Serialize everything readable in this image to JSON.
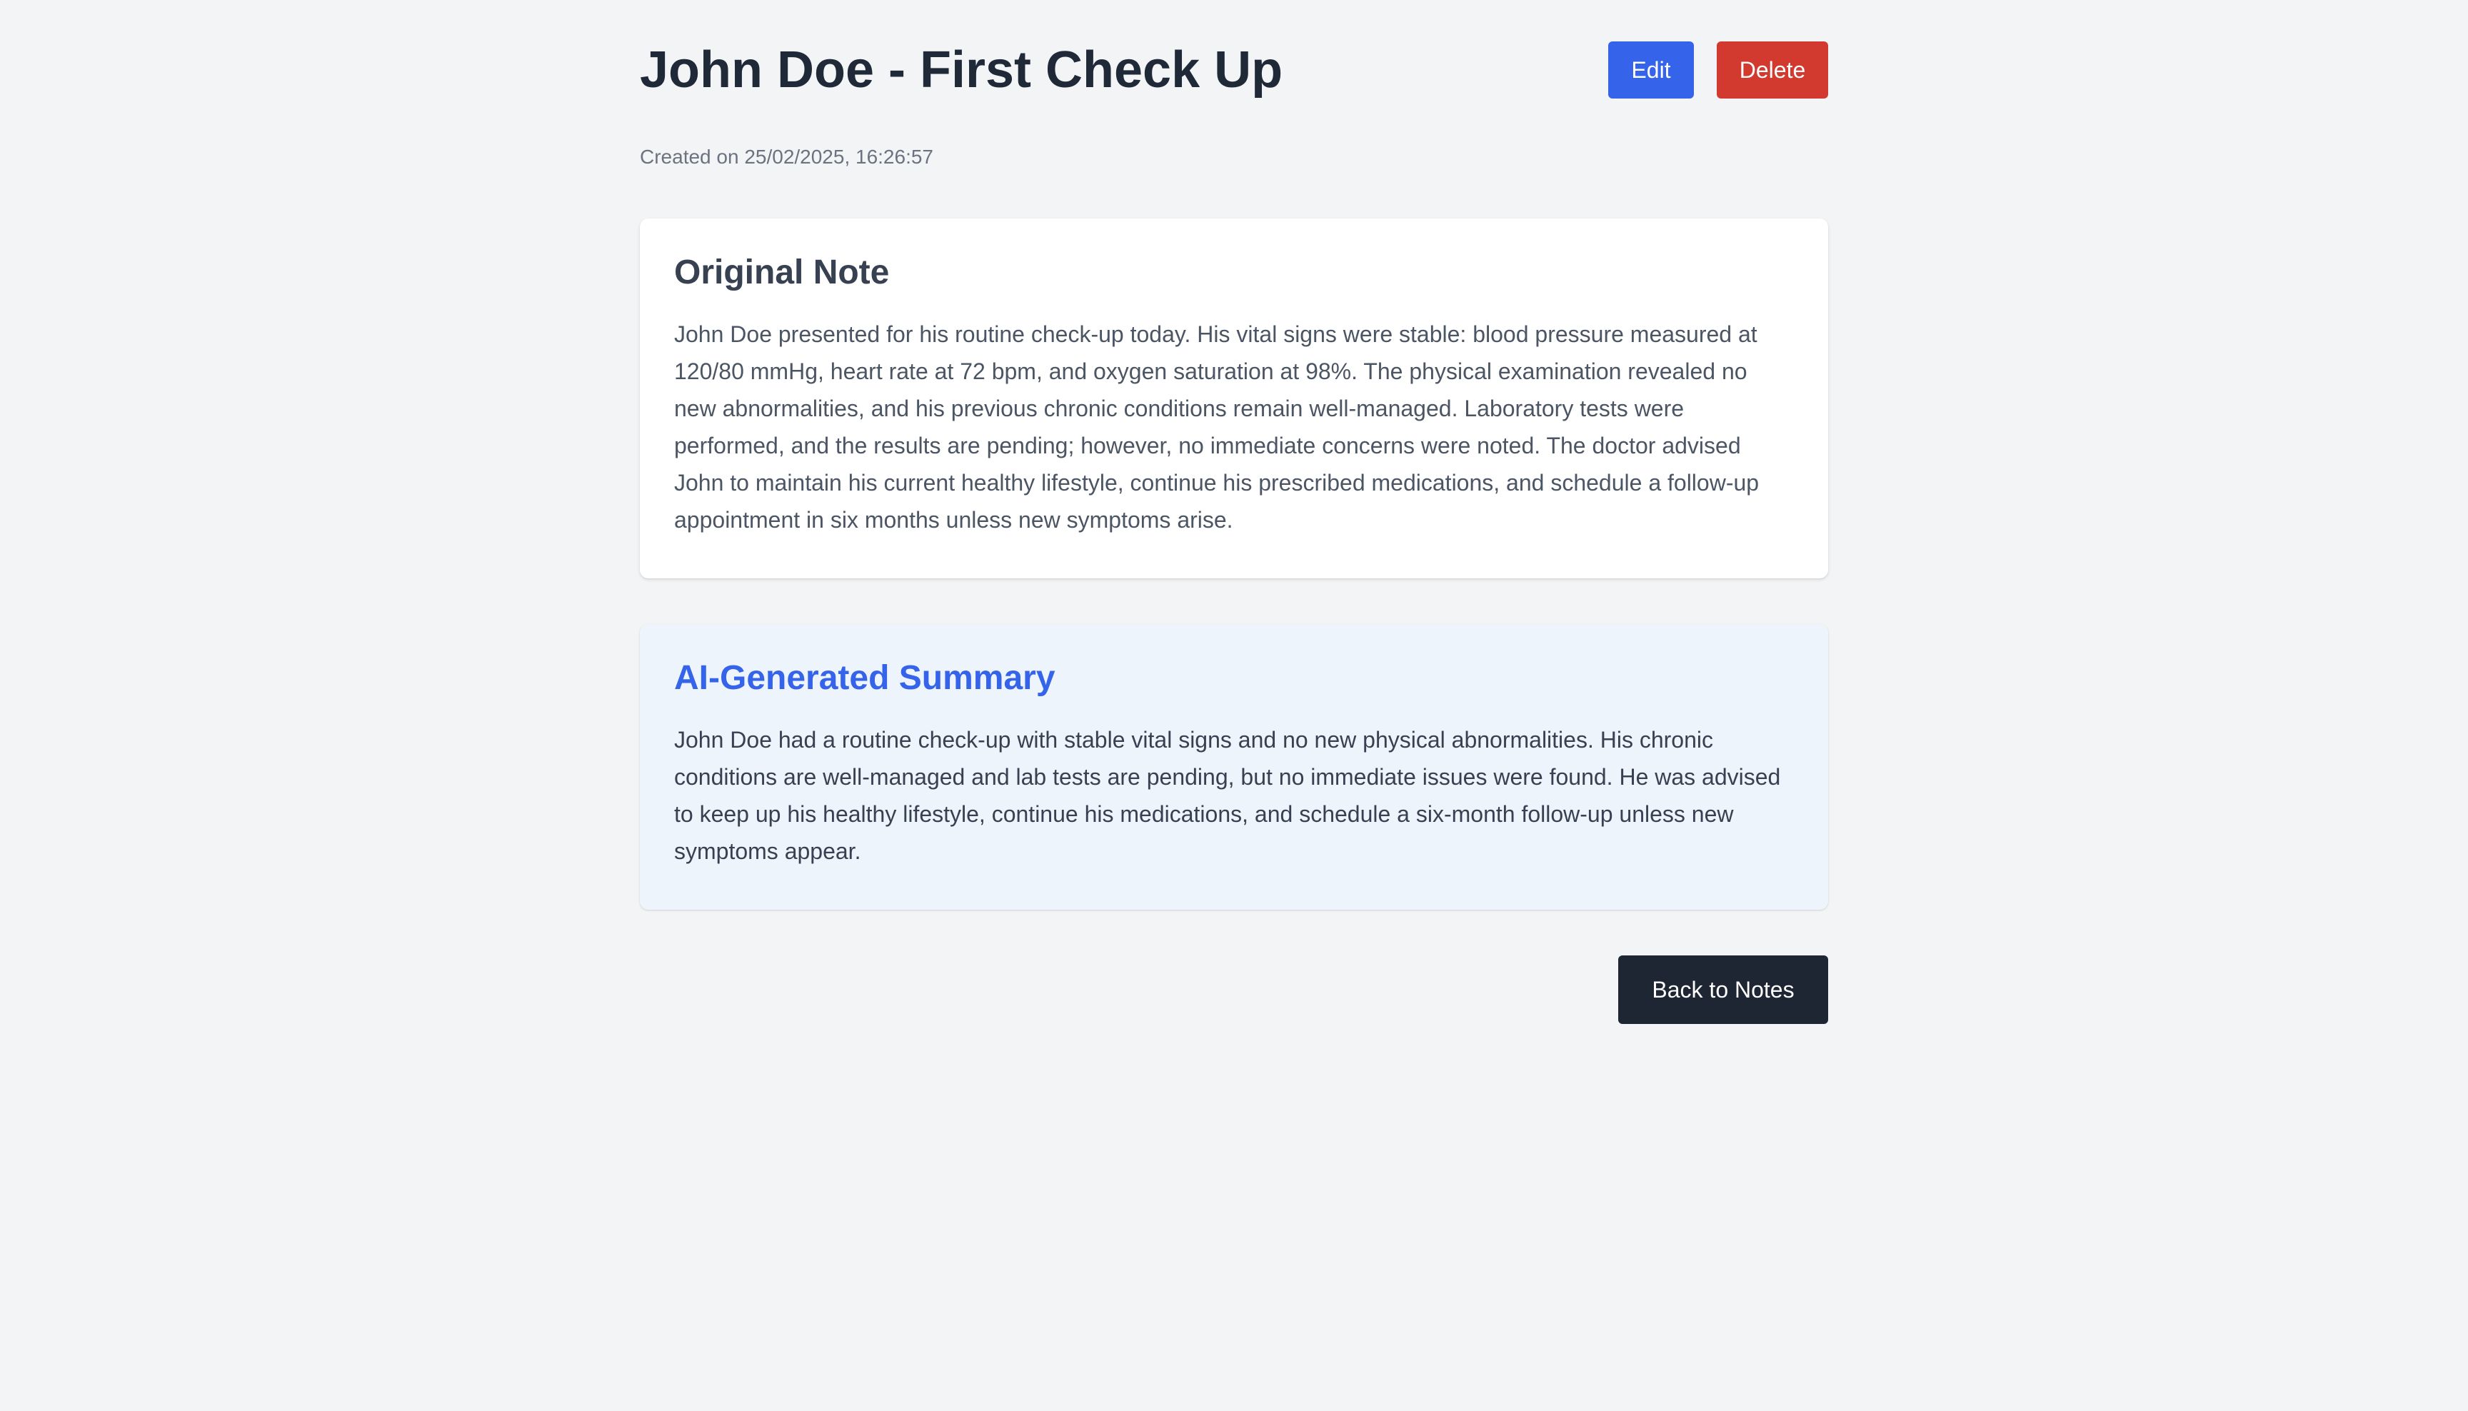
{
  "header": {
    "title": "John Doe - First Check Up",
    "edit_label": "Edit",
    "delete_label": "Delete"
  },
  "meta": {
    "created": "Created on 25/02/2025, 16:26:57"
  },
  "original_note": {
    "heading": "Original Note",
    "body": "John Doe presented for his routine check-up today. His vital signs were stable: blood pressure measured at 120/80 mmHg, heart rate at 72 bpm, and oxygen saturation at 98%. The physical examination revealed no new abnormalities, and his previous chronic conditions remain well-managed. Laboratory tests were performed, and the results are pending; however, no immediate concerns were noted. The doctor advised John to maintain his current healthy lifestyle, continue his prescribed medications, and schedule a follow-up appointment in six months unless new symptoms arise."
  },
  "summary": {
    "heading": "AI-Generated Summary",
    "body": "John Doe had a routine check-up with stable vital signs and no new physical abnormalities. His chronic conditions are well-managed and lab tests are pending, but no immediate issues were found. He was advised to keep up his healthy lifestyle, continue his medications, and schedule a six-month follow-up unless new symptoms appear."
  },
  "footer": {
    "back_label": "Back to Notes"
  },
  "colors": {
    "background": "#f3f4f6",
    "edit_button": "#3563e9",
    "delete_button": "#d23a2f",
    "back_button": "#1f2633",
    "summary_accent": "#3563e9",
    "summary_background": "#eef4fc"
  }
}
